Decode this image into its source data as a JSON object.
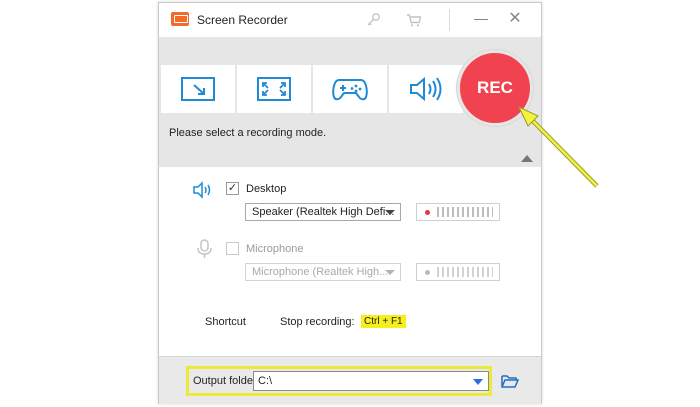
{
  "window": {
    "title": "Screen Recorder"
  },
  "modes": {
    "buttons": [
      {
        "name": "region",
        "icon": "region-capture-icon"
      },
      {
        "name": "fullscreen",
        "icon": "fullscreen-capture-icon"
      },
      {
        "name": "game",
        "icon": "gamepad-icon"
      },
      {
        "name": "audio",
        "icon": "speaker-icon"
      }
    ],
    "rec_label": "REC",
    "hint": "Please select a recording mode."
  },
  "audio": {
    "desktop": {
      "label": "Desktop",
      "checked": true,
      "checkmark": "✓",
      "device": "Speaker (Realtek High Defi..."
    },
    "microphone": {
      "label": "Microphone",
      "checked": false,
      "device": "Microphone (Realtek High..."
    }
  },
  "shortcut": {
    "label": "Shortcut",
    "stop_label": "Stop recording:",
    "stop_key": "Ctrl + F1"
  },
  "output": {
    "label": "Output folder:",
    "path": "C:\\"
  },
  "colors": {
    "rec": "#f1434f",
    "accent_blue": "#1f8ad6",
    "highlight": "#f5ef1b"
  }
}
